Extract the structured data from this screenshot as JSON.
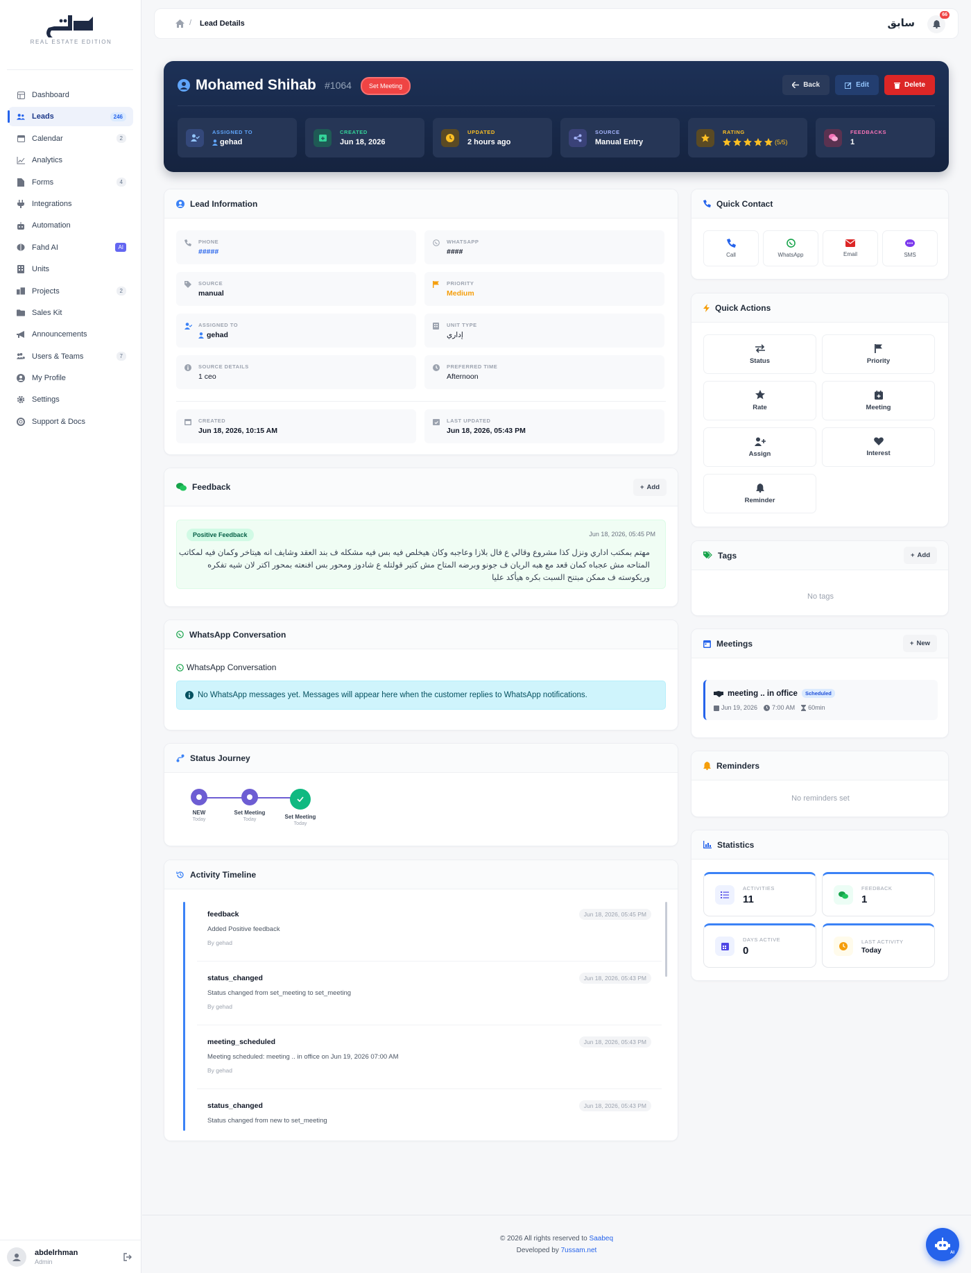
{
  "sidebar": {
    "logo_tagline": "REAL ESTATE EDITION",
    "items": [
      {
        "label": "Dashboard",
        "icon": "grid-icon",
        "badge": ""
      },
      {
        "label": "Leads",
        "icon": "users-icon",
        "badge": "246",
        "active": true
      },
      {
        "label": "Calendar",
        "icon": "calendar-icon",
        "badge": "2"
      },
      {
        "label": "Analytics",
        "icon": "chart-line-icon",
        "badge": ""
      },
      {
        "label": "Forms",
        "icon": "file-icon",
        "badge": "4"
      },
      {
        "label": "Integrations",
        "icon": "plug-icon",
        "badge": ""
      },
      {
        "label": "Automation",
        "icon": "robot-icon",
        "badge": ""
      },
      {
        "label": "Fahd AI",
        "icon": "brain-icon",
        "badge": "AI"
      },
      {
        "label": "Units",
        "icon": "building-icon",
        "badge": ""
      },
      {
        "label": "Projects",
        "icon": "city-icon",
        "badge": "2"
      },
      {
        "label": "Sales Kit",
        "icon": "folder-icon",
        "badge": ""
      },
      {
        "label": "Announcements",
        "icon": "megaphone-icon",
        "badge": ""
      },
      {
        "label": "Users & Teams",
        "icon": "users-cog-icon",
        "badge": "7"
      },
      {
        "label": "My Profile",
        "icon": "user-circle-icon",
        "badge": ""
      },
      {
        "label": "Settings",
        "icon": "gear-icon",
        "badge": ""
      },
      {
        "label": "Support & Docs",
        "icon": "life-ring-icon",
        "badge": ""
      }
    ],
    "user": {
      "name": "abdelrhman",
      "role": "Admin"
    }
  },
  "topbar": {
    "breadcrumb": "Lead Details",
    "brand": "سابق",
    "notifications": "66"
  },
  "hero": {
    "name": "Mohamed Shihab",
    "id": "#1064",
    "status": "Set Meeting",
    "buttons": {
      "back": "Back",
      "edit": "Edit",
      "delete": "Delete"
    },
    "meta": [
      {
        "label": "ASSIGNED TO",
        "value": "gehad",
        "color": "#60a5fa"
      },
      {
        "label": "CREATED",
        "value": "Jun 18, 2026",
        "color": "#34d399"
      },
      {
        "label": "UPDATED",
        "value": "2 hours ago",
        "color": "#fbbf24"
      },
      {
        "label": "SOURCE",
        "value": "Manual Entry",
        "color": "#a5b4fc"
      },
      {
        "label": "RATING",
        "value": "(5/5)",
        "stars": 5,
        "color": "#fbbf24"
      },
      {
        "label": "FEEDBACKS",
        "value": "1",
        "color": "#f472b6"
      }
    ]
  },
  "lead_info": {
    "title": "Lead Information",
    "fields": [
      {
        "label": "PHONE",
        "value": "#####"
      },
      {
        "label": "WHATSAPP",
        "value": "####"
      },
      {
        "label": "SOURCE",
        "value": "manual"
      },
      {
        "label": "PRIORITY",
        "value": "Medium"
      },
      {
        "label": "ASSIGNED TO",
        "value": "gehad"
      },
      {
        "label": "UNIT TYPE",
        "value": "إداري"
      },
      {
        "label": "SOURCE DETAILS",
        "value": "1  ceo"
      },
      {
        "label": "PREFERRED TIME",
        "value": "Afternoon"
      },
      {
        "label": "CREATED",
        "value": "Jun 18, 2026, 10:15 AM"
      },
      {
        "label": "LAST UPDATED",
        "value": "Jun 18, 2026, 05:43 PM"
      }
    ]
  },
  "feedback": {
    "title": "Feedback",
    "add_label": "Add",
    "item": {
      "tag": "Positive Feedback",
      "date": "Jun 18, 2026, 05:45 PM",
      "text": "مهتم بمكتب اداري ونزل كذا مشروع وقالي ع فال بلازا وعاجبه وكان هيخلص فيه بس فيه مشكله ف بند العقد وشايف انه هيتاخر وكمان فيه لمكاتب المتاحه مش عجباه كمان قعد مع هبه الريان ف جونو وبرضه المتاح مش كتير قولتله ع شادوز ومحور بس افنعته بمحور اكتر لان شيه تفكره وريكوسته ف ممكن مبتنح السبت بكره هيأكد عليا"
    }
  },
  "whatsapp": {
    "title": "WhatsApp Conversation",
    "subtitle": "WhatsApp Conversation",
    "empty": "No WhatsApp messages yet. Messages will appear here when the customer replies to WhatsApp notifications."
  },
  "journey": {
    "title": "Status Journey",
    "steps": [
      {
        "label": "NEW",
        "sub": "Today"
      },
      {
        "label": "Set Meeting",
        "sub": "Today"
      },
      {
        "label": "Set Meeting",
        "sub": "Today"
      }
    ]
  },
  "activity": {
    "title": "Activity Timeline",
    "items": [
      {
        "type": "feedback",
        "desc": "Added Positive feedback",
        "by": "By gehad",
        "date": "Jun 18, 2026, 05:45 PM"
      },
      {
        "type": "status_changed",
        "desc": "Status changed from set_meeting to set_meeting",
        "by": "By gehad",
        "date": "Jun 18, 2026, 05:43 PM"
      },
      {
        "type": "meeting_scheduled",
        "desc": "Meeting scheduled: meeting .. in office on Jun 19, 2026 07:00 AM",
        "by": "By gehad",
        "date": "Jun 18, 2026, 05:43 PM"
      },
      {
        "type": "status_changed",
        "desc": "Status changed from new to set_meeting",
        "by": "",
        "date": "Jun 18, 2026, 05:43 PM"
      }
    ]
  },
  "quick_contact": {
    "title": "Quick Contact",
    "items": [
      "Call",
      "WhatsApp",
      "Email",
      "SMS"
    ]
  },
  "quick_actions": {
    "title": "Quick Actions",
    "items": [
      "Status",
      "Priority",
      "Rate",
      "Meeting",
      "Assign",
      "Interest",
      "Reminder"
    ]
  },
  "tags": {
    "title": "Tags",
    "add_label": "Add",
    "empty": "No tags"
  },
  "meetings": {
    "title": "Meetings",
    "new_label": "New",
    "item": {
      "title": "meeting .. in office",
      "badge": "Scheduled",
      "date": "Jun 19, 2026",
      "time": "7:00 AM",
      "duration": "60min"
    }
  },
  "reminders": {
    "title": "Reminders",
    "empty": "No reminders set"
  },
  "statistics": {
    "title": "Statistics",
    "items": [
      {
        "label": "ACTIVITIES",
        "value": "11"
      },
      {
        "label": "FEEDBACK",
        "value": "1"
      },
      {
        "label": "DAYS ACTIVE",
        "value": "0"
      },
      {
        "label": "LAST ACTIVITY",
        "value": "Today"
      }
    ]
  },
  "footer": {
    "line1": "© 2026 All rights reserved to",
    "brand": "Saabeq",
    "line2": "Developed by",
    "dev": "7ussam.net"
  },
  "fab": {
    "badge": "AI"
  }
}
